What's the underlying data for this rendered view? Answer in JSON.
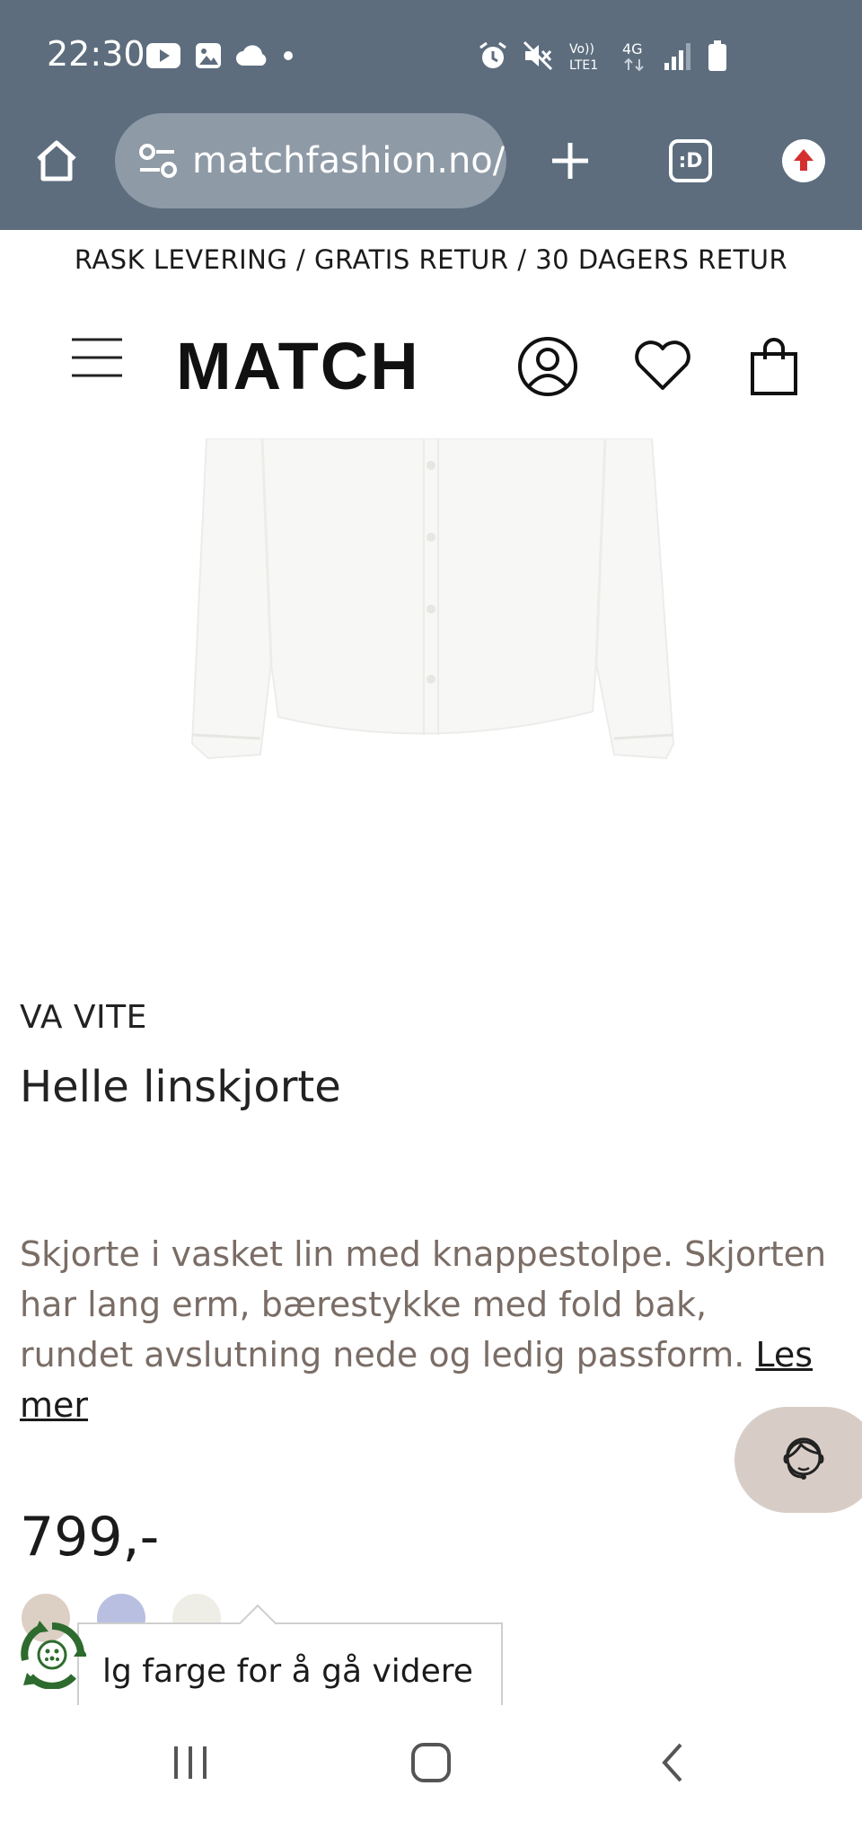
{
  "status_bar": {
    "time": "22:30",
    "left_icons": [
      "youtube-icon",
      "gallery-icon",
      "cloud-icon",
      "dot-icon"
    ],
    "right_icons": [
      "alarm-icon",
      "mute-icon",
      "volte-icon",
      "4g-icon",
      "signal-icon",
      "battery-icon"
    ],
    "volte_label": "Vo))\nLTE1",
    "network_label": "4G"
  },
  "browser": {
    "url": "matchfashion.no/",
    "tab_count": ":D"
  },
  "announcement": "RASK LEVERING / GRATIS RETUR / 30 DAGERS RETUR",
  "header": {
    "logo": "MATCH",
    "icons": [
      "menu-icon",
      "account-icon",
      "wishlist-icon",
      "cart-icon"
    ]
  },
  "product": {
    "brand": "VA VITE",
    "name": "Helle linskjorte",
    "description": "Skjorte i vasket lin med knappestolpe. Skjorten har lang erm, bærestykke med fold bak, rundet avslutning nede og ledig passform.",
    "read_more": "Les mer",
    "price": "799,-",
    "swatches": [
      {
        "color": "#dccfc4"
      },
      {
        "color": "#b9bfe0"
      },
      {
        "color": "#efeee6"
      }
    ]
  },
  "tooltip": {
    "text": "lg farge for å gå videre"
  },
  "colors": {
    "chrome": "#5d6d7e",
    "chat_button": "#d8cdc6",
    "eco_green": "#2e6b2e",
    "description_text": "#7a6d66"
  },
  "nav_bar": {
    "icons": [
      "recent-apps-icon",
      "home-icon",
      "back-icon"
    ]
  }
}
